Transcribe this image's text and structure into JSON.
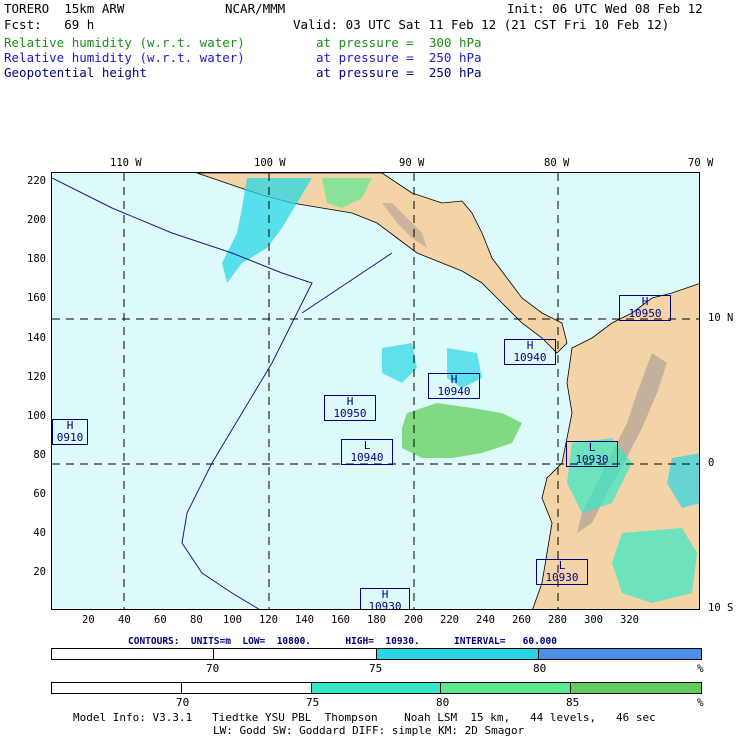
{
  "header": {
    "model": "TORERO  15km ARW",
    "org": "NCAR/MMM",
    "init": "Init: 06 UTC Wed 08 Feb 12",
    "fcst": "Fcst:   69 h",
    "valid": "Valid: 03 UTC Sat 11 Feb 12 (21 CST Fri 10 Feb 12)",
    "fields": [
      {
        "name": "Relative humidity (w.r.t. water)",
        "level": "at pressure =  300 hPa",
        "color": "#1a8c1a"
      },
      {
        "name": "Relative humidity (w.r.t. water)",
        "level": "at pressure =  250 hPa",
        "color": "#1a1acc"
      },
      {
        "name": "Geopotential height",
        "level": "at pressure =  250 hPa",
        "color": "#000080"
      }
    ]
  },
  "map": {
    "ocean_color": "#ddfafa",
    "land_color": "#f4d4a6",
    "top_ticks": [
      "110 W",
      "100 W",
      "90 W",
      "80 W",
      "70 W"
    ],
    "right_ticks": [
      "10 N",
      "0",
      "10 S"
    ],
    "x_ticks": [
      "20",
      "40",
      "60",
      "80",
      "100",
      "120",
      "140",
      "160",
      "180",
      "200",
      "220",
      "240",
      "260",
      "280",
      "300",
      "320"
    ],
    "y_ticks": [
      "220",
      "200",
      "180",
      "160",
      "140",
      "120",
      "100",
      "80",
      "60",
      "40",
      "20"
    ],
    "centers": [
      {
        "type": "H",
        "value": "10950"
      },
      {
        "type": "H",
        "value": "10940"
      },
      {
        "type": "H",
        "value": "10940"
      },
      {
        "type": "H",
        "value": "10950"
      },
      {
        "type": "H",
        "value": "0910"
      },
      {
        "type": "L",
        "value": "10940"
      },
      {
        "type": "L",
        "value": "10930"
      },
      {
        "type": "L",
        "value": "10930"
      },
      {
        "type": "H",
        "value": "10930"
      }
    ]
  },
  "contours_line": "CONTOURS:  UNITS=m  LOW=  10800.      HIGH=  10930.      INTERVAL=   60.000",
  "colorbars": [
    {
      "labels": [
        "70",
        "75",
        "80",
        "%"
      ],
      "colors": [
        "#ffffff",
        "#ffffff",
        "#29d6e6",
        "#4d8fe8"
      ]
    },
    {
      "labels": [
        "70",
        "75",
        "80",
        "85",
        "%"
      ],
      "colors": [
        "#ffffff",
        "#ffffff",
        "#33e8c8",
        "#5ce890",
        "#5fcf58"
      ]
    }
  ],
  "footer": {
    "line1": "Model Info: V3.3.1   Tiedtke YSU PBL  Thompson    Noah LSM  15 km,   44 levels,   46 sec",
    "line2": "LW: Godd SW: Goddard DIFF: simple KM: 2D Smagor"
  }
}
